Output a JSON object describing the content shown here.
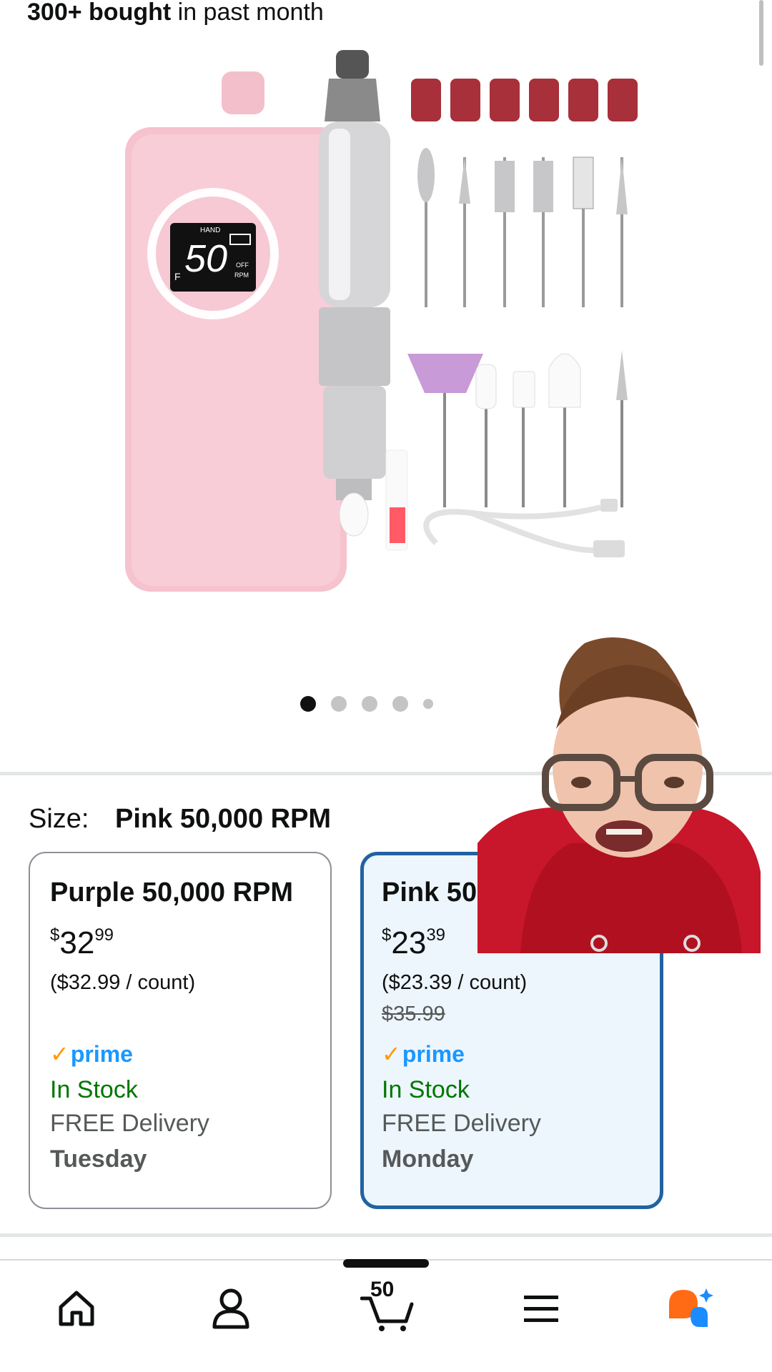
{
  "header": {
    "sold_bold": "300+ bought",
    "sold_rest": " in past month"
  },
  "carousel": {
    "active_index": 0,
    "dots": 5
  },
  "size": {
    "label": "Size:",
    "value": "Pink 50,000 RPM"
  },
  "options": [
    {
      "name": "Purple 50,000 RPM",
      "currency": "$",
      "price_whole": "32",
      "price_fraction": "99",
      "unit_price": "($32.99 / count)",
      "list_price": "",
      "prime": "prime",
      "stock": "In Stock",
      "delivery": "FREE Delivery",
      "day": "Tuesday",
      "selected": false
    },
    {
      "name": "Pink 50,000",
      "currency": "$",
      "price_whole": "23",
      "price_fraction": "39",
      "unit_price": "($23.39 / count)",
      "list_price": "$35.99",
      "prime": "prime",
      "stock": "In Stock",
      "delivery": "FREE Delivery",
      "day": "Monday",
      "selected": true
    }
  ],
  "display": {
    "screen_label": "HAND",
    "screen_number": "50",
    "screen_off": "OFF",
    "screen_rpm": "RPM",
    "screen_f": "F"
  },
  "nav": {
    "cart_count": "50",
    "items": [
      "home-icon",
      "account-icon",
      "cart-icon",
      "menu-icon",
      "rufus-icon"
    ]
  },
  "colors": {
    "selected_border": "#2162a1",
    "selected_bg": "#edf6fd",
    "prime_blue": "#1a98ff",
    "in_stock_green": "#007600"
  }
}
